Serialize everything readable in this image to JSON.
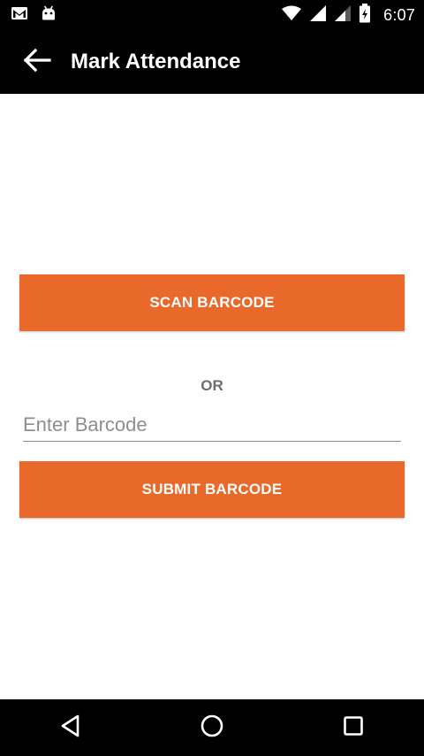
{
  "status_bar": {
    "time": "6:07",
    "icons": [
      "gmail-icon",
      "android-icon",
      "wifi-icon",
      "signal-icon",
      "signal-icon-2",
      "battery-icon"
    ]
  },
  "app_bar": {
    "title": "Mark Attendance",
    "back_icon": "arrow-left-icon"
  },
  "main": {
    "scan_button_label": "SCAN BARCODE",
    "or_label": "OR",
    "barcode_input": {
      "placeholder": "Enter Barcode",
      "value": ""
    },
    "submit_button_label": "SUBMIT BARCODE"
  },
  "nav_bar": {
    "icons": [
      "back-triangle-icon",
      "home-circle-icon",
      "recents-square-icon"
    ]
  },
  "colors": {
    "accent": "#E8692A",
    "bars": "#000000",
    "background": "#FFFFFF"
  }
}
